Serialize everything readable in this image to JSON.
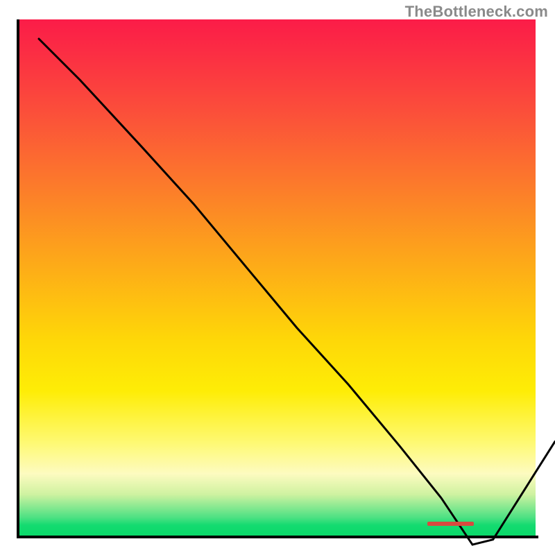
{
  "watermark": "TheBottleneck.com",
  "chart_data": {
    "type": "line",
    "title": "",
    "xlabel": "",
    "ylabel": "",
    "xlim": [
      0,
      100
    ],
    "ylim": [
      0,
      100
    ],
    "background_gradient": {
      "orientation": "vertical",
      "stops": [
        {
          "pos": 0,
          "color": "#fb1c48"
        },
        {
          "pos": 18,
          "color": "#fb4f3a"
        },
        {
          "pos": 46,
          "color": "#fda61a"
        },
        {
          "pos": 72,
          "color": "#feed06"
        },
        {
          "pos": 88,
          "color": "#fdfbc0"
        },
        {
          "pos": 96,
          "color": "#4de183"
        },
        {
          "pos": 100,
          "color": "#0ad96a"
        }
      ]
    },
    "series": [
      {
        "name": "bottleneck-curve",
        "x": [
          0,
          8,
          20,
          30,
          40,
          50,
          60,
          70,
          78,
          84,
          88,
          100
        ],
        "y": [
          100,
          92,
          79,
          68,
          56,
          44,
          33,
          21,
          11,
          2,
          3,
          22
        ],
        "stroke": "#000000",
        "stroke_width": 3
      }
    ],
    "markers": [
      {
        "name": "optimal-range",
        "x_start": 79,
        "x_end": 88,
        "y": 2.3,
        "color": "#d84a3f"
      }
    ],
    "axes": {
      "left": {
        "visible": true,
        "ticks": []
      },
      "bottom": {
        "visible": true,
        "ticks": []
      },
      "right": {
        "visible": false
      },
      "top": {
        "visible": false
      }
    }
  }
}
